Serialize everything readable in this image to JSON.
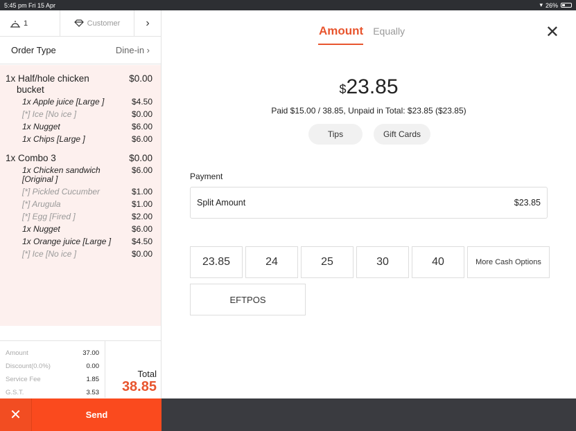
{
  "status_bar": {
    "time": "5:45 pm  Fri 15 Apr",
    "battery": "26%"
  },
  "order_header": {
    "guest_count": "1",
    "customer_label": "Customer",
    "next_icon": "chevron-right"
  },
  "order_type": {
    "label": "Order Type",
    "value": "Dine-in"
  },
  "order_items": {
    "i0": {
      "name": "1x Half/hole chicken bucket",
      "price": "$0.00"
    },
    "i0s0": {
      "name": "1x Apple juice [Large ]",
      "price": "$4.50"
    },
    "i0s1": {
      "name": "[*] Ice  [No ice ]",
      "price": "$0.00"
    },
    "i0s2": {
      "name": "1x Nugget",
      "price": "$6.00"
    },
    "i0s3": {
      "name": "1x Chips   [Large ]",
      "price": "$6.00"
    },
    "i1": {
      "name": "1x Combo 3",
      "price": "$0.00"
    },
    "i1s0": {
      "name": "1x Chicken sandwich [Original ]",
      "price": "$6.00"
    },
    "i1s1": {
      "name": "[*] Pickled Cucumber",
      "price": "$1.00"
    },
    "i1s2": {
      "name": "[*] Arugula",
      "price": "$1.00"
    },
    "i1s3": {
      "name": "[*] Egg  [Fired ]",
      "price": "$2.00"
    },
    "i1s4": {
      "name": "1x Nugget",
      "price": "$6.00"
    },
    "i1s5": {
      "name": "1x Orange juice [Large ]",
      "price": "$4.50"
    },
    "i1s6": {
      "name": "[*] Ice  [No ice ]",
      "price": "$0.00"
    }
  },
  "totals": {
    "amount_label": "Amount",
    "amount": "37.00",
    "discount_label": "Discount(0.0%)",
    "discount": "0.00",
    "service_label": "Service Fee",
    "service": "1.85",
    "gst_label": "G.S.T.",
    "gst": "3.53",
    "total_label": "Total",
    "total": "38.85"
  },
  "actions": {
    "send_label": "Send"
  },
  "payment": {
    "tab_amount": "Amount",
    "tab_equally": "Equally",
    "currency": "$",
    "amount": "23.85",
    "paid_line": "Paid $15.00 / 38.85, Unpaid in Total: $23.85 ($23.85)",
    "tips_label": "Tips",
    "gift_cards_label": "Gift Cards",
    "section_label": "Payment",
    "split_label": "Split Amount",
    "split_value": "$23.85",
    "cash_options": [
      "23.85",
      "24",
      "25",
      "30",
      "40"
    ],
    "more_cash_label": "More Cash Options",
    "eftpos_label": "EFTPOS"
  },
  "colors": {
    "accent": "#e8552e",
    "send_bg": "#fa4a1e",
    "order_bg": "#fdf0ee",
    "dark_bar": "#3a3b40"
  }
}
